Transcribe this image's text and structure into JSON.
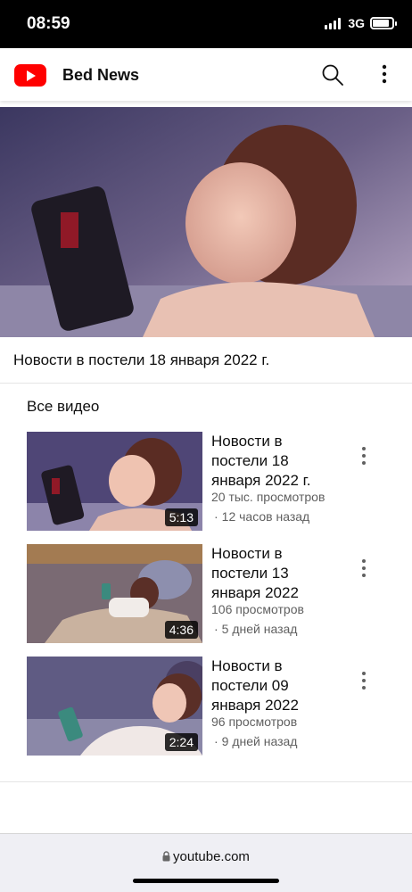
{
  "status_bar": {
    "time": "08:59",
    "network": "3G",
    "battery_level": 0.85
  },
  "header": {
    "channel_name": "Bed News",
    "logo_icon": "youtube-logo-icon",
    "search_icon": "search-icon",
    "menu_icon": "more-vert-icon"
  },
  "featured": {
    "title": "Новости в постели 18 января 2022 г."
  },
  "section": {
    "title": "Все видео"
  },
  "videos": [
    {
      "title": "Новости в постели 18 января 2022 г.",
      "views": "20 тыс. просмотров",
      "time": "12 часов назад",
      "duration": "5:13"
    },
    {
      "title": "Новости в постели 13 января 2022",
      "views": "106 просмотров",
      "time": "5 дней назад",
      "duration": "4:36"
    },
    {
      "title": "Новости в постели 09 января 2022",
      "views": "96 просмотров",
      "time": "9 дней назад",
      "duration": "2:24"
    }
  ],
  "browser": {
    "url": "youtube.com"
  },
  "colors": {
    "brand": "#ff0000",
    "text": "#0f0f0f",
    "secondary_text": "#606060"
  }
}
